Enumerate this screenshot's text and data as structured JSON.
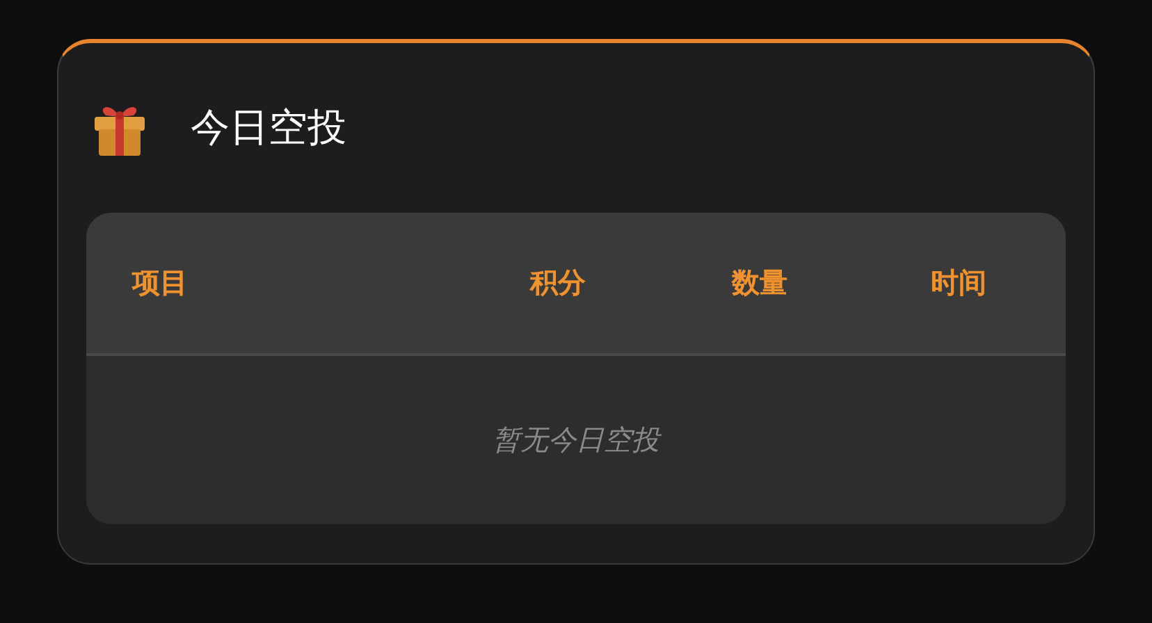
{
  "card": {
    "title": "今日空投"
  },
  "table": {
    "columns": [
      "项目",
      "积分",
      "数量",
      "时间"
    ],
    "empty_message": "暂无今日空投"
  }
}
